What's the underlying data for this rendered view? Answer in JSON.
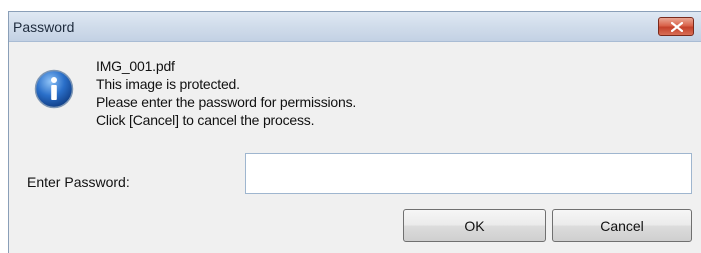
{
  "dialog": {
    "title": "Password",
    "icon": "info-icon",
    "message": {
      "filename": "IMG_001.pdf",
      "line1": "This image is protected.",
      "line2": "Please enter the password for permissions.",
      "line3": "Click [Cancel] to cancel the process."
    },
    "password": {
      "label": "Enter Password:",
      "value": "",
      "placeholder": ""
    },
    "buttons": {
      "ok_label": "OK",
      "cancel_label": "Cancel"
    }
  },
  "colors": {
    "titlebar": "#cfdbea",
    "close_button": "#c4412b",
    "icon_blue": "#2a6fc9",
    "dialog_bg": "#f0f0f0"
  }
}
